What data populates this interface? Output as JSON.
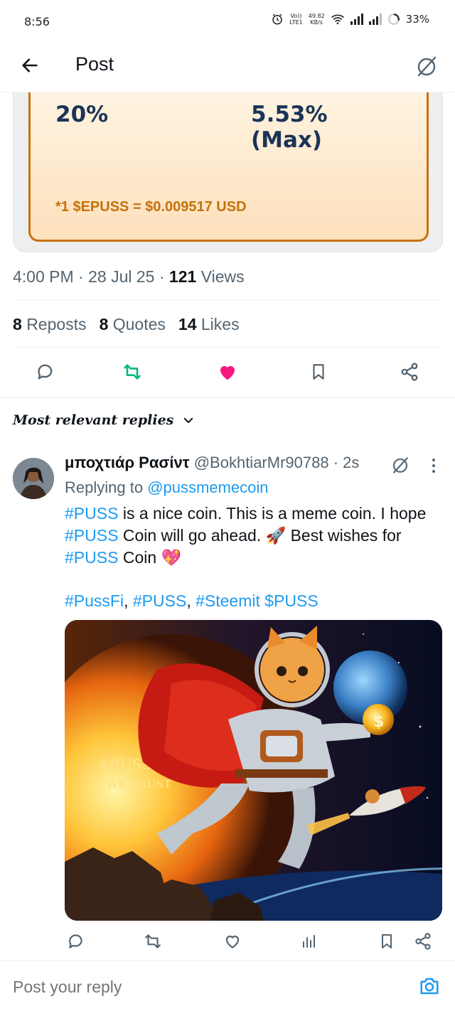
{
  "status_bar": {
    "time": "8:56",
    "network_top": "49.82",
    "network_bottom": "KB/s",
    "volte_top": "Vo))",
    "volte_bottom": "LTE1",
    "battery": "33%"
  },
  "header": {
    "title": "Post"
  },
  "card": {
    "rate_left": "20%",
    "rate_right_line1": "5.53%",
    "rate_right_line2": "(Max)",
    "price": "*1 $EPUSS = $0.009517 USD"
  },
  "meta": {
    "time": "4:00 PM",
    "date": "28 Jul 25",
    "views_count": "121",
    "views_label": "Views"
  },
  "stats": {
    "reposts_count": "8",
    "reposts_label": "Reposts",
    "quotes_count": "8",
    "quotes_label": "Quotes",
    "likes_count": "14",
    "likes_label": "Likes"
  },
  "replies_filter": {
    "label": "Most relevant replies"
  },
  "reply": {
    "name": "μποχτιάρ Ρασίντ",
    "handle": "@BokhtiarMr90788",
    "time": "· 2s",
    "replying_prefix": "Replying to",
    "replying_handle": "@pussmemecoin",
    "text_line1_tag": "#PUSS",
    "text_line1_rest": " is a nice coin. This is a meme coin. I hope",
    "text_line2_tag": "#PUSS",
    "text_line2_rest": " Coin will go ahead. 🚀 Best wishes for",
    "text_line3_tag": "#PUSS",
    "text_line3_rest": " Coin 💖",
    "tag1": "#PussFi",
    "sep1": ", ",
    "tag2": "#PUSS",
    "sep2": ", ",
    "tag3": "#Steemit",
    "sep3": " ",
    "tag4": "$PUSS",
    "image_text_1": "$PUSS",
    "image_text_2": "WE TRUST"
  },
  "compose": {
    "placeholder": "Post your reply"
  },
  "colors": {
    "link_blue": "#1d9bf0",
    "repost_green": "#00ba7c",
    "like_pink": "#f91880",
    "muted_gray": "#536471",
    "card_border": "#c7710d",
    "card_navy": "#1b3457"
  },
  "icons": [
    "back-arrow-icon",
    "grok-icon",
    "reply-icon",
    "repost-icon",
    "like-icon",
    "bookmark-icon",
    "share-icon",
    "chevron-down-icon",
    "more-icon",
    "analytics-icon",
    "camera-icon"
  ]
}
